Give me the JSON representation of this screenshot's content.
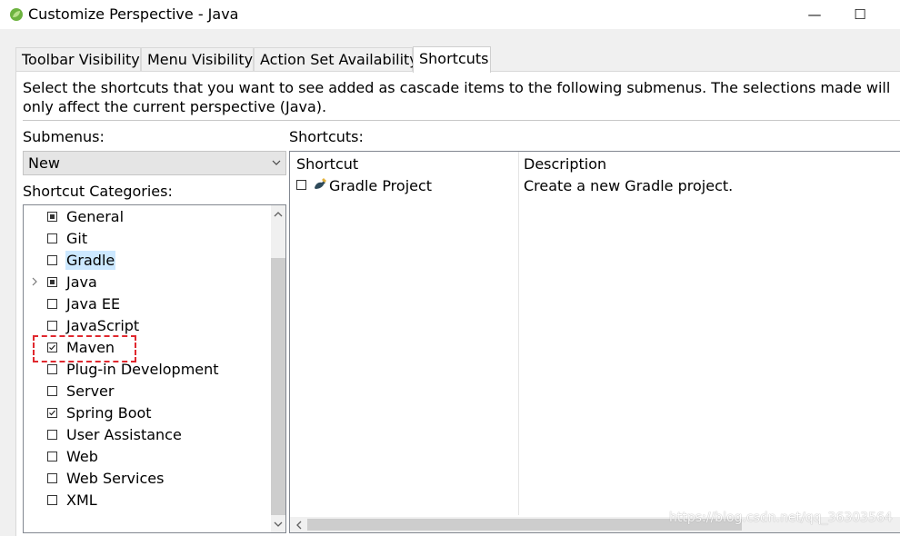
{
  "window": {
    "title": "Customize Perspective - Java",
    "minimize_glyph": "—",
    "maximize_glyph": "☐"
  },
  "tabs": [
    {
      "label": "Toolbar Visibility",
      "active": false
    },
    {
      "label": "Menu Visibility",
      "active": false
    },
    {
      "label": "Action Set Availability",
      "active": false
    },
    {
      "label": "Shortcuts",
      "active": true
    }
  ],
  "description": "Select the shortcuts that you want to see added as cascade items to the following submenus.  The selections made will only affect the current perspective (Java).",
  "submenus": {
    "label": "Submenus:",
    "selected": "New"
  },
  "categories": {
    "label": "Shortcut Categories:",
    "items": [
      {
        "label": "General",
        "state": "partial",
        "expandable": false,
        "selected": false
      },
      {
        "label": "Git",
        "state": "unchecked",
        "expandable": false,
        "selected": false
      },
      {
        "label": "Gradle",
        "state": "unchecked",
        "expandable": false,
        "selected": true
      },
      {
        "label": "Java",
        "state": "partial",
        "expandable": true,
        "selected": false
      },
      {
        "label": "Java EE",
        "state": "unchecked",
        "expandable": false,
        "selected": false
      },
      {
        "label": "JavaScript",
        "state": "unchecked",
        "expandable": false,
        "selected": false
      },
      {
        "label": "Maven",
        "state": "checked",
        "expandable": false,
        "selected": false
      },
      {
        "label": "Plug-in Development",
        "state": "unchecked",
        "expandable": false,
        "selected": false
      },
      {
        "label": "Server",
        "state": "unchecked",
        "expandable": false,
        "selected": false
      },
      {
        "label": "Spring Boot",
        "state": "checked",
        "expandable": false,
        "selected": false
      },
      {
        "label": "User Assistance",
        "state": "unchecked",
        "expandable": false,
        "selected": false
      },
      {
        "label": "Web",
        "state": "unchecked",
        "expandable": false,
        "selected": false
      },
      {
        "label": "Web Services",
        "state": "unchecked",
        "expandable": false,
        "selected": false
      },
      {
        "label": "XML",
        "state": "unchecked",
        "expandable": false,
        "selected": false
      }
    ]
  },
  "shortcuts": {
    "label": "Shortcuts:",
    "columns": [
      "Shortcut",
      "Description"
    ],
    "rows": [
      {
        "shortcut": "Gradle Project",
        "description": "Create a new Gradle project.",
        "checked": false
      }
    ]
  },
  "watermark": "https://blog.csdn.net/qq_36303564",
  "colors": {
    "highlight": "#e0282e",
    "selection": "#cce8ff",
    "spring_green": "#6db33f"
  }
}
